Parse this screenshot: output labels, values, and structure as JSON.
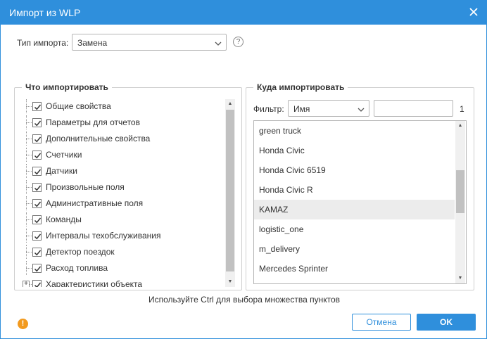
{
  "window": {
    "title": "Импорт из WLP"
  },
  "import_type": {
    "label": "Тип импорта:",
    "value": "Замена"
  },
  "what_group": {
    "legend": "Что импортировать",
    "items": [
      {
        "label": "Общие свойства",
        "checked": true
      },
      {
        "label": "Параметры для отчетов",
        "checked": true
      },
      {
        "label": "Дополнительные свойства",
        "checked": true
      },
      {
        "label": "Счетчики",
        "checked": true
      },
      {
        "label": "Датчики",
        "checked": true
      },
      {
        "label": "Произвольные поля",
        "checked": true
      },
      {
        "label": "Административные поля",
        "checked": true
      },
      {
        "label": "Команды",
        "checked": true
      },
      {
        "label": "Интервалы техобслуживания",
        "checked": true
      },
      {
        "label": "Детектор поездок",
        "checked": true
      },
      {
        "label": "Расход топлива",
        "checked": true
      },
      {
        "label": "Характеристики объекта",
        "checked": true,
        "expandable": true
      }
    ]
  },
  "where_group": {
    "legend": "Куда импортировать",
    "filter_label": "Фильтр:",
    "filter_field": "Имя",
    "filter_value": "",
    "count": "1",
    "objects": [
      {
        "name": "green truck",
        "selected": false
      },
      {
        "name": "Honda Civic",
        "selected": false
      },
      {
        "name": "Honda Civic 6519",
        "selected": false
      },
      {
        "name": "Honda Civic R",
        "selected": false
      },
      {
        "name": "KAMAZ",
        "selected": true
      },
      {
        "name": "logistic_one",
        "selected": false
      },
      {
        "name": "m_delivery",
        "selected": false
      },
      {
        "name": "Mercedes Sprinter",
        "selected": false
      }
    ]
  },
  "hint": "Используйте Ctrl для выбора множества пунктов",
  "buttons": {
    "cancel": "Отмена",
    "ok": "OK"
  },
  "colors": {
    "accent": "#2f8fdc",
    "warning": "#f29a1f",
    "selected_row": "#ececec"
  }
}
